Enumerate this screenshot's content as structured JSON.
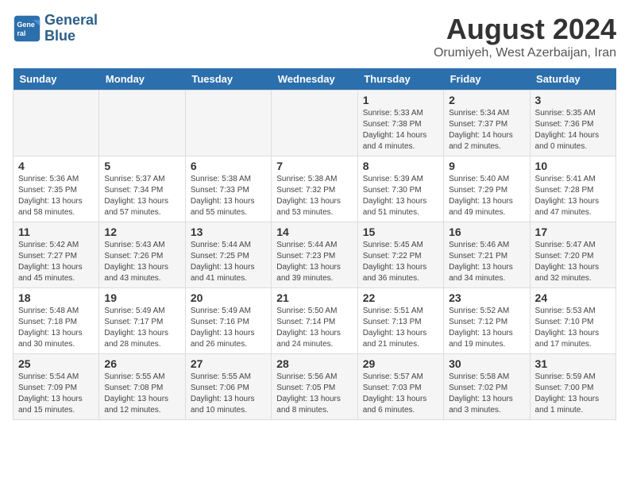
{
  "logo": {
    "line1": "General",
    "line2": "Blue"
  },
  "title": "August 2024",
  "subtitle": "Orumiyeh, West Azerbaijan, Iran",
  "days_of_week": [
    "Sunday",
    "Monday",
    "Tuesday",
    "Wednesday",
    "Thursday",
    "Friday",
    "Saturday"
  ],
  "weeks": [
    [
      {
        "day": "",
        "info": ""
      },
      {
        "day": "",
        "info": ""
      },
      {
        "day": "",
        "info": ""
      },
      {
        "day": "",
        "info": ""
      },
      {
        "day": "1",
        "info": "Sunrise: 5:33 AM\nSunset: 7:38 PM\nDaylight: 14 hours and 4 minutes."
      },
      {
        "day": "2",
        "info": "Sunrise: 5:34 AM\nSunset: 7:37 PM\nDaylight: 14 hours and 2 minutes."
      },
      {
        "day": "3",
        "info": "Sunrise: 5:35 AM\nSunset: 7:36 PM\nDaylight: 14 hours and 0 minutes."
      }
    ],
    [
      {
        "day": "4",
        "info": "Sunrise: 5:36 AM\nSunset: 7:35 PM\nDaylight: 13 hours and 58 minutes."
      },
      {
        "day": "5",
        "info": "Sunrise: 5:37 AM\nSunset: 7:34 PM\nDaylight: 13 hours and 57 minutes."
      },
      {
        "day": "6",
        "info": "Sunrise: 5:38 AM\nSunset: 7:33 PM\nDaylight: 13 hours and 55 minutes."
      },
      {
        "day": "7",
        "info": "Sunrise: 5:38 AM\nSunset: 7:32 PM\nDaylight: 13 hours and 53 minutes."
      },
      {
        "day": "8",
        "info": "Sunrise: 5:39 AM\nSunset: 7:30 PM\nDaylight: 13 hours and 51 minutes."
      },
      {
        "day": "9",
        "info": "Sunrise: 5:40 AM\nSunset: 7:29 PM\nDaylight: 13 hours and 49 minutes."
      },
      {
        "day": "10",
        "info": "Sunrise: 5:41 AM\nSunset: 7:28 PM\nDaylight: 13 hours and 47 minutes."
      }
    ],
    [
      {
        "day": "11",
        "info": "Sunrise: 5:42 AM\nSunset: 7:27 PM\nDaylight: 13 hours and 45 minutes."
      },
      {
        "day": "12",
        "info": "Sunrise: 5:43 AM\nSunset: 7:26 PM\nDaylight: 13 hours and 43 minutes."
      },
      {
        "day": "13",
        "info": "Sunrise: 5:44 AM\nSunset: 7:25 PM\nDaylight: 13 hours and 41 minutes."
      },
      {
        "day": "14",
        "info": "Sunrise: 5:44 AM\nSunset: 7:23 PM\nDaylight: 13 hours and 39 minutes."
      },
      {
        "day": "15",
        "info": "Sunrise: 5:45 AM\nSunset: 7:22 PM\nDaylight: 13 hours and 36 minutes."
      },
      {
        "day": "16",
        "info": "Sunrise: 5:46 AM\nSunset: 7:21 PM\nDaylight: 13 hours and 34 minutes."
      },
      {
        "day": "17",
        "info": "Sunrise: 5:47 AM\nSunset: 7:20 PM\nDaylight: 13 hours and 32 minutes."
      }
    ],
    [
      {
        "day": "18",
        "info": "Sunrise: 5:48 AM\nSunset: 7:18 PM\nDaylight: 13 hours and 30 minutes."
      },
      {
        "day": "19",
        "info": "Sunrise: 5:49 AM\nSunset: 7:17 PM\nDaylight: 13 hours and 28 minutes."
      },
      {
        "day": "20",
        "info": "Sunrise: 5:49 AM\nSunset: 7:16 PM\nDaylight: 13 hours and 26 minutes."
      },
      {
        "day": "21",
        "info": "Sunrise: 5:50 AM\nSunset: 7:14 PM\nDaylight: 13 hours and 24 minutes."
      },
      {
        "day": "22",
        "info": "Sunrise: 5:51 AM\nSunset: 7:13 PM\nDaylight: 13 hours and 21 minutes."
      },
      {
        "day": "23",
        "info": "Sunrise: 5:52 AM\nSunset: 7:12 PM\nDaylight: 13 hours and 19 minutes."
      },
      {
        "day": "24",
        "info": "Sunrise: 5:53 AM\nSunset: 7:10 PM\nDaylight: 13 hours and 17 minutes."
      }
    ],
    [
      {
        "day": "25",
        "info": "Sunrise: 5:54 AM\nSunset: 7:09 PM\nDaylight: 13 hours and 15 minutes."
      },
      {
        "day": "26",
        "info": "Sunrise: 5:55 AM\nSunset: 7:08 PM\nDaylight: 13 hours and 12 minutes."
      },
      {
        "day": "27",
        "info": "Sunrise: 5:55 AM\nSunset: 7:06 PM\nDaylight: 13 hours and 10 minutes."
      },
      {
        "day": "28",
        "info": "Sunrise: 5:56 AM\nSunset: 7:05 PM\nDaylight: 13 hours and 8 minutes."
      },
      {
        "day": "29",
        "info": "Sunrise: 5:57 AM\nSunset: 7:03 PM\nDaylight: 13 hours and 6 minutes."
      },
      {
        "day": "30",
        "info": "Sunrise: 5:58 AM\nSunset: 7:02 PM\nDaylight: 13 hours and 3 minutes."
      },
      {
        "day": "31",
        "info": "Sunrise: 5:59 AM\nSunset: 7:00 PM\nDaylight: 13 hours and 1 minute."
      }
    ]
  ]
}
